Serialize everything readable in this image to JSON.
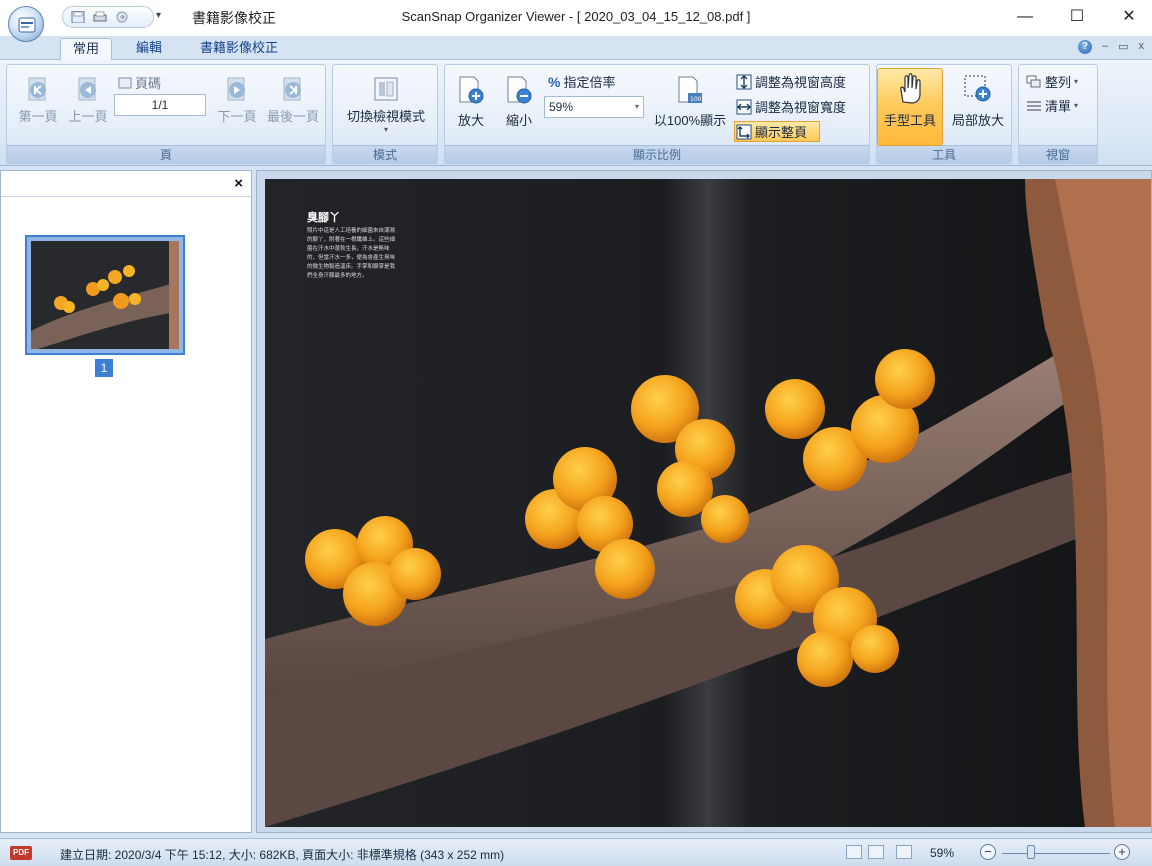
{
  "app": {
    "document_title": "書籍影像校正",
    "window_title": "ScanSnap Organizer Viewer - [ 2020_03_04_15_12_08.pdf ]",
    "window_buttons": {
      "minimize": "—",
      "maximize": "☐",
      "close": "✕"
    }
  },
  "tabs": [
    {
      "label": "常用",
      "active": true
    },
    {
      "label": "編輯",
      "active": false
    },
    {
      "label": "書籍影像校正",
      "active": false
    }
  ],
  "ribbon_right": {
    "help": "?",
    "minimize": "–",
    "restore": "▭",
    "close": "x"
  },
  "ribbon": {
    "page_group": {
      "label": "頁",
      "first": "第一頁",
      "prev": "上一頁",
      "page_label": "頁碼",
      "page_value": "1/1",
      "next": "下一頁",
      "last": "最後一頁"
    },
    "mode_group": {
      "label": "模式",
      "switch": "切換檢視模式"
    },
    "zoom_group": {
      "label": "顯示比例",
      "zoom_in": "放大",
      "zoom_out": "縮小",
      "specify_label": "指定倍率",
      "specify_value": "59%",
      "actual": "以100%顯示",
      "fit_height": "調整為視窗高度",
      "fit_width": "調整為視窗寬度",
      "fit_page": "顯示整頁"
    },
    "tools_group": {
      "label": "工具",
      "hand": "手型工具",
      "loupe": "局部放大"
    },
    "window_group": {
      "label": "視窗",
      "arrange": "整列",
      "list": "清單"
    }
  },
  "thumbnails": {
    "close": "×",
    "page_number": "1"
  },
  "page_content": {
    "title": "臭腳丫",
    "body": "照片中這是人工培養的細菌來自潮濕的腳丫，附著在一根纖維上。這些細菌在汗水中蓬勃生長，汗水是無味的，但當汗水一多，便為會產生臭味的微生物製造溫床。手掌和腳掌是我們全身汗腺最多的地方。"
  },
  "statusbar": {
    "badge": "PDF",
    "info": "建立日期: 2020/3/4 下午 15:12, 大小: 682KB, 頁面大小: 非標準規格 (343 x 252 mm)",
    "zoom": "59%",
    "zoom_level": 0.27,
    "zoom_out": "−",
    "zoom_in": "+"
  },
  "colors": {
    "accent": "#3c7fd4",
    "ribbon": "#dce8f6",
    "active_tool": "#ffc858"
  }
}
